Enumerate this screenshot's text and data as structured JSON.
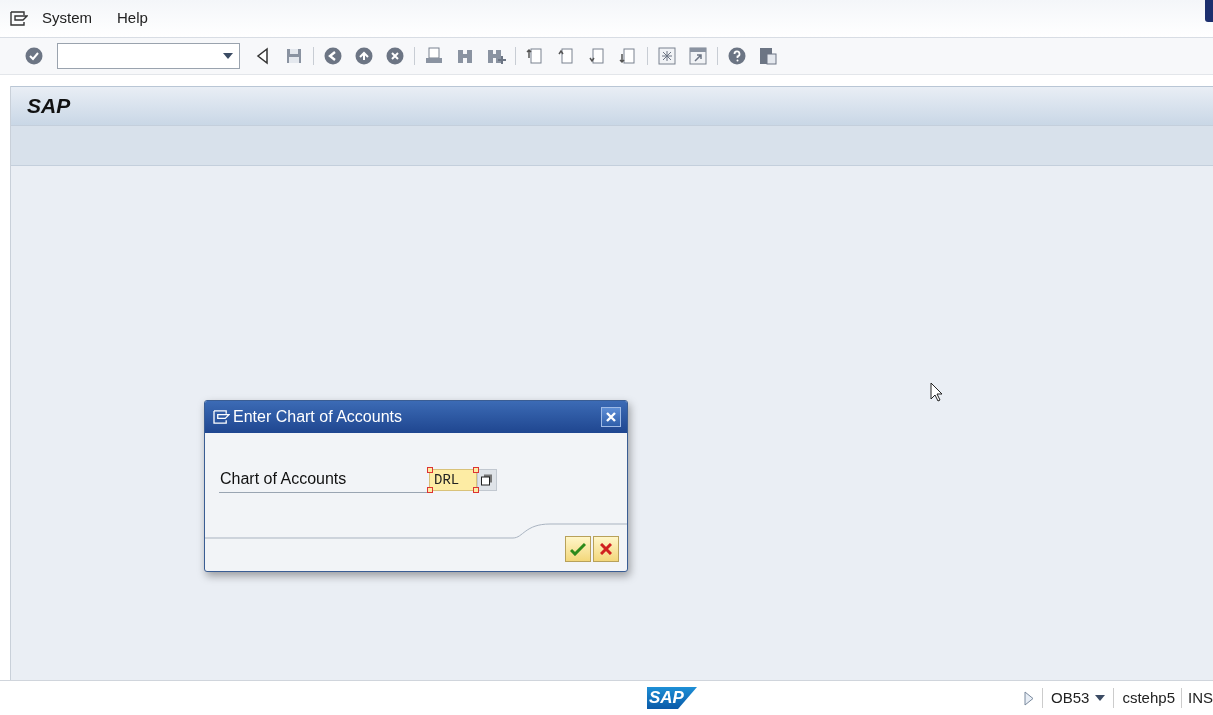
{
  "menu": [
    {
      "label": "System"
    },
    {
      "label": "Help"
    }
  ],
  "title": "SAP",
  "dialog": {
    "title": "Enter Chart of Accounts",
    "field_label": "Chart of Accounts",
    "field_value": "DRL"
  },
  "status_bar": {
    "logo": "SAP",
    "transaction": "OB53",
    "server": "cstehp5",
    "mode": "INS"
  }
}
